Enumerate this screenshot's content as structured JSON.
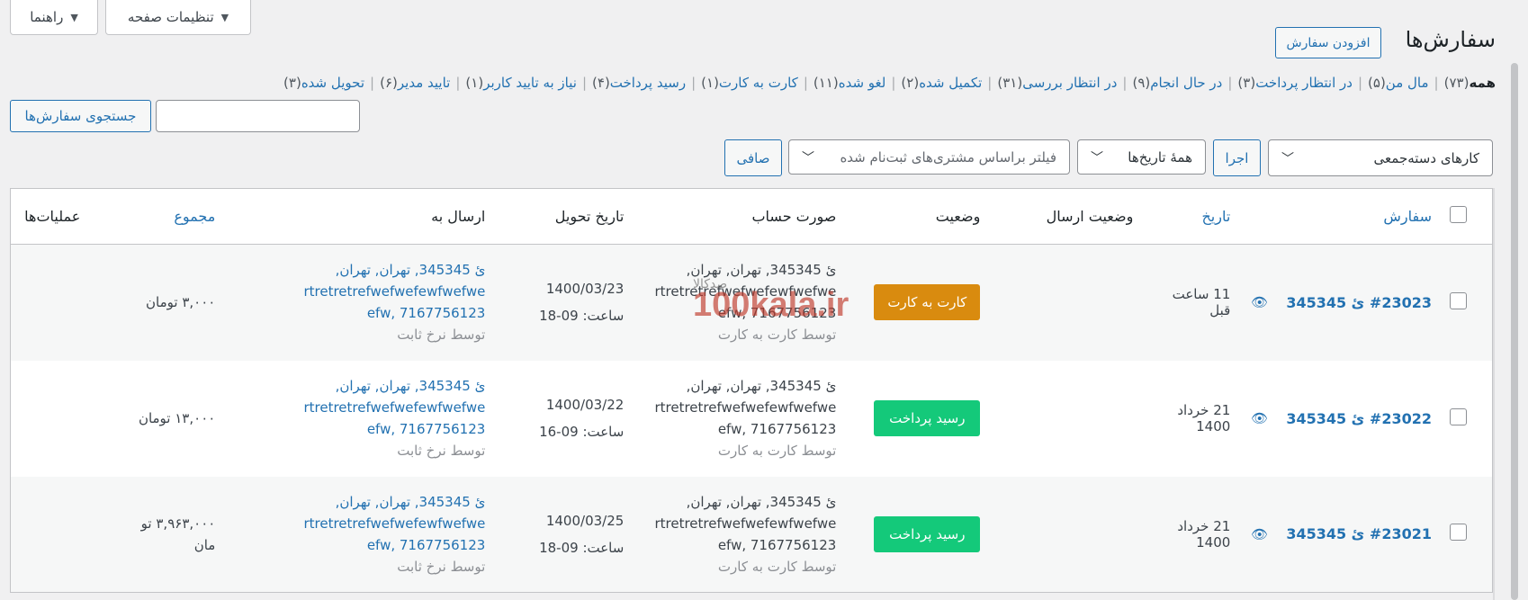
{
  "screen_options": {
    "page_settings": "تنظیمات صفحه",
    "help": "راهنما"
  },
  "header": {
    "title": "سفارش‌ها",
    "add_order": "افزودن سفارش"
  },
  "views": [
    {
      "label": "همه",
      "count": "(۷۳)",
      "current": true
    },
    {
      "label": "مال من",
      "count": "(۵)"
    },
    {
      "label": "در انتظار پرداخت",
      "count": "(۳)"
    },
    {
      "label": "در حال انجام",
      "count": "(۹)"
    },
    {
      "label": "در انتظار بررسی",
      "count": "(۳۱)"
    },
    {
      "label": "تکمیل شده",
      "count": "(۲)"
    },
    {
      "label": "لغو شده",
      "count": "(۱۱)"
    },
    {
      "label": "کارت به کارت",
      "count": "(۱)"
    },
    {
      "label": "رسید پرداخت",
      "count": "(۴)"
    },
    {
      "label": "نیاز به تایید کاربر",
      "count": "(۱)"
    },
    {
      "label": "تایید مدیر",
      "count": "(۶)"
    },
    {
      "label": "تحویل شده",
      "count": "(۳)"
    }
  ],
  "search": {
    "button": "جستجوی سفارش‌ها",
    "value": ""
  },
  "filters": {
    "bulk_actions": "کارهای دسته‌جمعی",
    "apply": "اجرا",
    "all_dates": "همهٔ تاریخ‌ها",
    "customer_filter": "فیلتر براساس مشتری‌های ثبت‌نام شده",
    "filter": "صافی"
  },
  "table": {
    "columns": {
      "order": "سفارش",
      "date": "تاریخ",
      "shipping_status": "وضعیت ارسال",
      "status": "وضعیت",
      "billing": "صورت حساب",
      "delivery_date": "تاریخ تحویل",
      "ship_to": "ارسال به",
      "total": "مجموع",
      "actions": "عملیات‌ها"
    },
    "rows": [
      {
        "order": "#23023 ئ 345345",
        "date": "11 ساعت قبل",
        "status": "کارت به کارت",
        "status_color": "#d98b0f",
        "billing_line1": "ئ 345345, تهران, تهران,",
        "billing_line2": "rtretretrefwefwefewfwefwe",
        "billing_line3": "efw, 7167756123",
        "billing_via": "توسط کارت به کارت",
        "delivery_date": "1400/03/23",
        "delivery_time": "ساعت: 09-18",
        "ship_line1": "ئ 345345, تهران, تهران,",
        "ship_line2": "rtretretrefwefwefewfwefwe",
        "ship_line3": "efw, 7167756123",
        "ship_via": "توسط نرخ ثابت",
        "total": "۳,۰۰۰ تومان"
      },
      {
        "order": "#23022 ئ 345345",
        "date": "21 خرداد 1400",
        "status": "رسید پرداخت",
        "status_color": "#14c97a",
        "billing_line1": "ئ 345345, تهران, تهران,",
        "billing_line2": "rtretretrefwefwefewfwefwe",
        "billing_line3": "efw, 7167756123",
        "billing_via": "توسط کارت به کارت",
        "delivery_date": "1400/03/22",
        "delivery_time": "ساعت: 09-16",
        "ship_line1": "ئ 345345, تهران, تهران,",
        "ship_line2": "rtretretrefwefwefewfwefwe",
        "ship_line3": "efw, 7167756123",
        "ship_via": "توسط نرخ ثابت",
        "total": "۱۳,۰۰۰ تومان"
      },
      {
        "order": "#23021 ئ 345345",
        "date": "21 خرداد 1400",
        "status": "رسید پرداخت",
        "status_color": "#14c97a",
        "billing_line1": "ئ 345345, تهران, تهران,",
        "billing_line2": "rtretretrefwefwefewfwefwe",
        "billing_line3": "efw, 7167756123",
        "billing_via": "توسط کارت به کارت",
        "delivery_date": "1400/03/25",
        "delivery_time": "ساعت: 09-18",
        "ship_line1": "ئ 345345, تهران, تهران,",
        "ship_line2": "rtretretrefwefwefewfwefwe",
        "ship_line3": "efw, 7167756123",
        "ship_via": "توسط نرخ ثابت",
        "total_line1": "۳,۹۶۳,۰۰۰ تو",
        "total_line2": "مان"
      }
    ]
  },
  "watermark": {
    "text": "100kala.ir",
    "sub": "صدکالا"
  },
  "icons": {
    "preview": "eye-icon",
    "caret": "caret-down-icon",
    "chevron": "chevron-down-icon"
  },
  "colors": {
    "link": "#2271b1",
    "card_to_card": "#d98b0f",
    "payment_receipt": "#14c97a"
  }
}
